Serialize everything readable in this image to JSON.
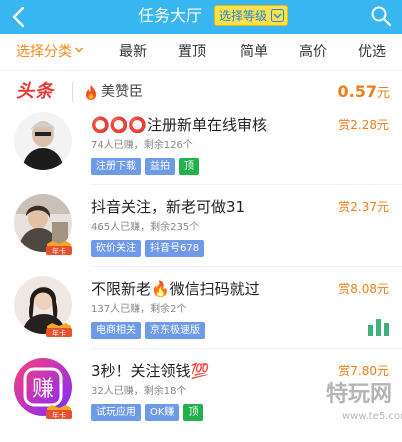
{
  "header": {
    "title": "任务大厅",
    "level_select": "选择等级",
    "bg_color": "#38b6f0",
    "icons": {
      "back": "chevron-left-icon",
      "search": "search-icon",
      "dropdown": "chevron-down-icon"
    }
  },
  "filters": {
    "tabs": [
      {
        "label": "选择分类",
        "active": true
      },
      {
        "label": "最新"
      },
      {
        "label": "置顶"
      },
      {
        "label": "简单"
      },
      {
        "label": "高价"
      },
      {
        "label": "优选"
      }
    ],
    "active_color": "#f28a1e"
  },
  "headline": {
    "badge": "头条",
    "user": "美赞臣",
    "amount": "0.57",
    "unit": "元"
  },
  "tasks": [
    {
      "title": "⭕⭕⭕注册新单在线审核",
      "meta": "74人已赚，剩余126个",
      "reward_prefix": "赏",
      "reward": "2.28",
      "unit": "元",
      "tags": [
        {
          "label": "注册下载",
          "color": "#6f9ae8"
        },
        {
          "label": "益拍",
          "color": "#6f9ae8"
        },
        {
          "label": "顶",
          "color": "#23b14d"
        }
      ]
    },
    {
      "title": "抖音关注，新老可做31",
      "meta": "465人已赚，剩余235个",
      "reward_prefix": "赏",
      "reward": "2.37",
      "unit": "元",
      "year_badge": "年卡",
      "tags": [
        {
          "label": "砍价关注",
          "color": "#6f9ae8"
        },
        {
          "label": "抖音号678",
          "color": "#6f9ae8"
        }
      ]
    },
    {
      "title": "不限新老🔥微信扫码就过",
      "meta": "137人已赚，剩余2个",
      "reward_prefix": "赏",
      "reward": "8.08",
      "unit": "元",
      "year_badge": "年卡",
      "tags": [
        {
          "label": "电商相关",
          "color": "#6f9ae8"
        },
        {
          "label": "京东极速版",
          "color": "#6f9ae8"
        }
      ]
    },
    {
      "title": "3秒！关注领钱💯",
      "meta": "32人已赚，剩余18个",
      "reward_prefix": "赏",
      "reward": "7.80",
      "unit": "元",
      "year_badge": "年卡",
      "avatar_text": "赚",
      "tags": [
        {
          "label": "试玩应用",
          "color": "#6f9ae8"
        },
        {
          "label": "OK赚",
          "color": "#6f9ae8"
        },
        {
          "label": "顶",
          "color": "#23b14d"
        }
      ]
    }
  ],
  "watermark": {
    "main": "特玩网",
    "sub": "www.te5.com"
  }
}
